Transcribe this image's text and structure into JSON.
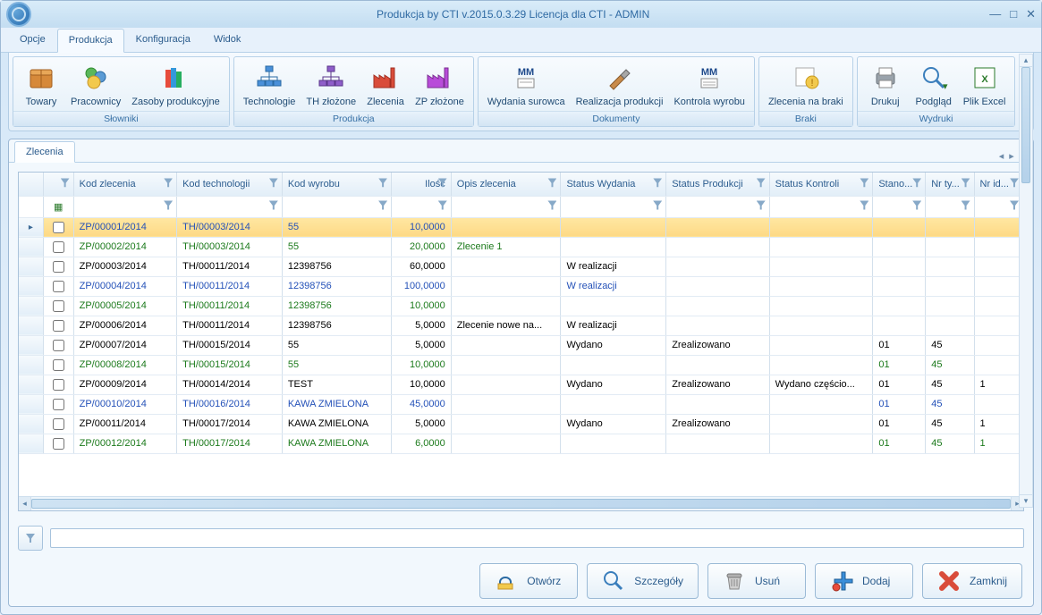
{
  "window": {
    "title": "Produkcja by CTI v.2015.0.3.29 Licencja dla CTI - ADMIN"
  },
  "menu": {
    "items": [
      "Opcje",
      "Produkcja",
      "Konfiguracja",
      "Widok"
    ],
    "active": 1
  },
  "ribbon": {
    "groups": [
      {
        "title": "Słowniki",
        "items": [
          {
            "label": "Towary",
            "icon": "box"
          },
          {
            "label": "Pracownicy",
            "icon": "people"
          },
          {
            "label": "Zasoby produkcyjne",
            "icon": "books"
          }
        ]
      },
      {
        "title": "Produkcja",
        "items": [
          {
            "label": "Technologie",
            "icon": "org"
          },
          {
            "label": "TH złożone",
            "icon": "org2"
          },
          {
            "label": "Zlecenia",
            "icon": "factory"
          },
          {
            "label": "ZP złożone",
            "icon": "factory2"
          }
        ]
      },
      {
        "title": "Dokumenty",
        "items": [
          {
            "label": "Wydania surowca",
            "icon": "mm"
          },
          {
            "label": "Realizacja produkcji",
            "icon": "hammer"
          },
          {
            "label": "Kontrola wyrobu",
            "icon": "mm2"
          }
        ]
      },
      {
        "title": "Braki",
        "items": [
          {
            "label": "Zlecenia na braki",
            "icon": "warn"
          }
        ]
      },
      {
        "title": "Wydruki",
        "items": [
          {
            "label": "Drukuj",
            "icon": "print"
          },
          {
            "label": "Podgląd",
            "icon": "preview"
          },
          {
            "label": "Plik Excel",
            "icon": "excel"
          }
        ]
      }
    ]
  },
  "doc_tab": "Zlecenia",
  "columns": [
    {
      "label": "",
      "cls": "col-ind"
    },
    {
      "label": "",
      "cls": "col-chk"
    },
    {
      "label": "Kod zlecenia",
      "cls": "col-kod"
    },
    {
      "label": "Kod technologii",
      "cls": "col-tech"
    },
    {
      "label": "Kod wyrobu",
      "cls": "col-wyrob"
    },
    {
      "label": "Ilość",
      "cls": "col-ilosc"
    },
    {
      "label": "Opis zlecenia",
      "cls": "col-opis"
    },
    {
      "label": "Status Wydania",
      "cls": "col-swyd"
    },
    {
      "label": "Status Produkcji",
      "cls": "col-sprod"
    },
    {
      "label": "Status Kontroli",
      "cls": "col-skon"
    },
    {
      "label": "Stano...",
      "cls": "col-stan"
    },
    {
      "label": "Nr ty...",
      "cls": "col-nrt"
    },
    {
      "label": "Nr id...",
      "cls": "col-nri"
    }
  ],
  "rows": [
    {
      "sel": true,
      "style": "blue",
      "kod": "ZP/00001/2014",
      "tech": "TH/00003/2014",
      "wyrob": "55",
      "ilosc": "10,0000",
      "opis": "",
      "swyd": "",
      "sprod": "",
      "skon": "",
      "stan": "",
      "nrt": "",
      "nri": ""
    },
    {
      "style": "green",
      "kod": "ZP/00002/2014",
      "tech": "TH/00003/2014",
      "wyrob": "55",
      "ilosc": "20,0000",
      "opis": "Zlecenie 1",
      "swyd": "",
      "sprod": "",
      "skon": "",
      "stan": "",
      "nrt": "",
      "nri": ""
    },
    {
      "style": "",
      "kod": "ZP/00003/2014",
      "tech": "TH/00011/2014",
      "wyrob": "12398756",
      "ilosc": "60,0000",
      "opis": "",
      "swyd": "W realizacji",
      "sprod": "",
      "skon": "",
      "stan": "",
      "nrt": "",
      "nri": ""
    },
    {
      "style": "blue",
      "kod": "ZP/00004/2014",
      "tech": "TH/00011/2014",
      "wyrob": "12398756",
      "ilosc": "100,0000",
      "opis": "",
      "swyd": "W realizacji",
      "sprod": "",
      "skon": "",
      "stan": "",
      "nrt": "",
      "nri": ""
    },
    {
      "style": "green",
      "kod": "ZP/00005/2014",
      "tech": "TH/00011/2014",
      "wyrob": "12398756",
      "ilosc": "10,0000",
      "opis": "",
      "swyd": "",
      "sprod": "",
      "skon": "",
      "stan": "",
      "nrt": "",
      "nri": ""
    },
    {
      "style": "",
      "kod": "ZP/00006/2014",
      "tech": "TH/00011/2014",
      "wyrob": "12398756",
      "ilosc": "5,0000",
      "opis": "Zlecenie nowe na...",
      "swyd": "W realizacji",
      "sprod": "",
      "skon": "",
      "stan": "",
      "nrt": "",
      "nri": ""
    },
    {
      "style": "",
      "kod": "ZP/00007/2014",
      "tech": "TH/00015/2014",
      "wyrob": "55",
      "ilosc": "5,0000",
      "opis": "",
      "swyd": "Wydano",
      "sprod": "Zrealizowano",
      "skon": "",
      "stan": "01",
      "nrt": "45",
      "nri": ""
    },
    {
      "style": "green",
      "kod": "ZP/00008/2014",
      "tech": "TH/00015/2014",
      "wyrob": "55",
      "ilosc": "10,0000",
      "opis": "",
      "swyd": "",
      "sprod": "",
      "skon": "",
      "stan": "01",
      "nrt": "45",
      "nri": ""
    },
    {
      "style": "",
      "kod": "ZP/00009/2014",
      "tech": "TH/00014/2014",
      "wyrob": "TEST",
      "ilosc": "10,0000",
      "opis": "",
      "swyd": "Wydano",
      "sprod": "Zrealizowano",
      "skon": "Wydano częścio...",
      "stan": "01",
      "nrt": "45",
      "nri": "1"
    },
    {
      "style": "blue",
      "kod": "ZP/00010/2014",
      "tech": "TH/00016/2014",
      "wyrob": "KAWA ZMIELONA",
      "ilosc": "45,0000",
      "opis": "",
      "swyd": "",
      "sprod": "",
      "skon": "",
      "stan": "01",
      "nrt": "45",
      "nri": ""
    },
    {
      "style": "",
      "kod": "ZP/00011/2014",
      "tech": "TH/00017/2014",
      "wyrob": "KAWA ZMIELONA",
      "ilosc": "5,0000",
      "opis": "",
      "swyd": "Wydano",
      "sprod": "Zrealizowano",
      "skon": "",
      "stan": "01",
      "nrt": "45",
      "nri": "1"
    },
    {
      "style": "green",
      "kod": "ZP/00012/2014",
      "tech": "TH/00017/2014",
      "wyrob": "KAWA ZMIELONA",
      "ilosc": "6,0000",
      "opis": "",
      "swyd": "",
      "sprod": "",
      "skon": "",
      "stan": "01",
      "nrt": "45",
      "nri": "1"
    }
  ],
  "filter": {
    "placeholder": ""
  },
  "actions": [
    {
      "label": "Otwórz",
      "icon": "open"
    },
    {
      "label": "Szczegóły",
      "icon": "details"
    },
    {
      "label": "Usuń",
      "icon": "delete"
    },
    {
      "label": "Dodaj",
      "icon": "add"
    },
    {
      "label": "Zamknij",
      "icon": "close"
    }
  ],
  "ribbon_icons": {
    "box": "<rect x='5' y='12' width='24' height='16' rx='2' fill='#d6893a' stroke='#a15e1f'/><rect x='5' y='8' width='24' height='6' rx='2' fill='#e8a758' stroke='#a15e1f'/><line x1='17' y1='8' x2='17' y2='28' stroke='#a15e1f'/>",
    "people": "<circle cx='12' cy='12' r='6' fill='#5bb75b' stroke='#2f8b2f'/><circle cx='22' cy='16' r='6' fill='#5b9bd5' stroke='#2a6aa3'/><circle cx='15' cy='22' r='7' fill='#f2c94c' stroke='#c7952a'/>",
    "books": "<rect x='6' y='8' width='6' height='20' fill='#e74c3c'/><rect x='12' y='6' width='6' height='22' fill='#3498db'/><rect x='18' y='10' width='6' height='18' fill='#27ae60'/>",
    "org": "<rect x='13' y='4' width='8' height='6' fill='#4a90d9' stroke='#2a6aa3'/><rect x='4' y='20' width='8' height='6' fill='#4a90d9' stroke='#2a6aa3'/><rect x='13' y='20' width='8' height='6' fill='#4a90d9' stroke='#2a6aa3'/><rect x='22' y='20' width='8' height='6' fill='#4a90d9' stroke='#2a6aa3'/><path d='M17 10 V16 M17 16 H8 V20 M17 16 V20 M17 16 H26 V20' stroke='#2a6aa3' fill='none'/>",
    "org2": "<rect x='13' y='4' width='8' height='6' fill='#8e5ec9' stroke='#5a368a'/><rect x='4' y='20' width='8' height='6' fill='#8e5ec9' stroke='#5a368a'/><rect x='13' y='20' width='8' height='6' fill='#8e5ec9' stroke='#5a368a'/><rect x='22' y='20' width='8' height='6' fill='#8e5ec9' stroke='#5a368a'/><path d='M17 10 V16 M17 16 H8 V20 M17 16 V20 M17 16 H26 V20' stroke='#5a368a' fill='none'/>",
    "factory": "<path d='M4 28 V14 L10 18 V14 L16 18 V14 L22 18 V28 Z' fill='#d94c3a' stroke='#a12f22'/><rect x='23' y='6' width='4' height='22' fill='#d94c3a' stroke='#a12f22'/>",
    "factory2": "<path d='M4 28 V14 L10 18 V14 L16 18 V14 L22 18 V28 Z' fill='#b84cd9' stroke='#7a2f91'/><rect x='23' y='6' width='4' height='22' fill='#b84cd9' stroke='#7a2f91'/>",
    "mm": "<text x='17' y='14' text-anchor='middle' font-size='12' font-weight='bold' fill='#1f4a8c'>MM</text><rect x='8' y='18' width='18' height='10' fill='#fff' stroke='#888'/><line x1='10' y1='22' x2='24' y2='22' stroke='#aaa'/>",
    "hammer": "<path d='M6 26 L18 14 L22 18 L10 30 Z' fill='#c98b4a' stroke='#8a5a2a'/><path d='M18 14 L24 8 L28 12 L22 18 Z' fill='#a8a8a8' stroke='#666'/>",
    "mm2": "<text x='17' y='14' text-anchor='middle' font-size='12' font-weight='bold' fill='#1f4a8c'>MM</text><rect x='8' y='18' width='18' height='10' fill='#fff' stroke='#888'/><line x1='10' y1='22' x2='24' y2='22' stroke='#aaa'/><line x1='10' y1='25' x2='24' y2='25' stroke='#aaa'/>",
    "warn": "<rect x='6' y='6' width='20' height='20' fill='#fff' stroke='#aaa'/><circle cx='24' cy='22' r='7' fill='#f2c94c' stroke='#c79a1f'/><text x='24' y='26' text-anchor='middle' font-size='10' fill='#a06800'>!</text>",
    "print": "<rect x='7' y='12' width='20' height='12' rx='2' fill='#9aa3ab' stroke='#6a737b'/><rect x='10' y='6' width='14' height='8' fill='#fff' stroke='#888'/><rect x='10' y='20' width='14' height='8' fill='#fff' stroke='#888'/>",
    "preview": "<circle cx='14' cy='14' r='8' fill='none' stroke='#3a7ebc' stroke-width='2'/><line x1='20' y1='20' x2='28' y2='28' stroke='#3a7ebc' stroke-width='3'/><text x='27' y='30' font-size='10' fill='#2a7a2a'>▾</text>",
    "excel": "<rect x='6' y='6' width='22' height='22' fill='#fff' stroke='#2a7a2a'/><text x='17' y='22' text-anchor='middle' font-size='14' font-weight='bold' fill='#2a7a2a'>X</text>"
  },
  "action_icons": {
    "open": "<path d='M6 14 A6 5 0 0 1 18 14 V18 H6 Z' fill='none' stroke='#2a6aa3' stroke-width='2'/><rect x='4' y='16' width='16' height='6' fill='#f2c94c' stroke='#c7952a'/>",
    "details": "<circle cx='10' cy='10' r='7' fill='none' stroke='#3a7ebc' stroke-width='2'/><line x1='15' y1='15' x2='22' y2='22' stroke='#3a7ebc' stroke-width='3'/>",
    "delete": "<path d='M6 8 H20 L18 22 H8 Z' fill='#d0d0d0' stroke='#888'/><rect x='5' y='5' width='16' height='4' rx='2' fill='#b0b0b0' stroke='#777'/><line x1='10' y1='11' x2='10' y2='19' stroke='#888'/><line x1='13' y1='11' x2='13' y2='19' stroke='#888'/><line x1='16' y1='11' x2='16' y2='19' stroke='#888'/>",
    "add": "<path d='M13 3 H17 V11 H25 V15 H17 V23 H13 V15 H5 V11 H13 Z' fill='#3a8ed9' stroke='#1f5c93'/><circle cx='7' cy='20' r='4' fill='#e74c3c' stroke='#a12f22'/>",
    "close": "<path d='M5 5 L21 21 M21 5 L5 21' stroke='#d94c3a' stroke-width='6' stroke-linecap='round'/>"
  }
}
